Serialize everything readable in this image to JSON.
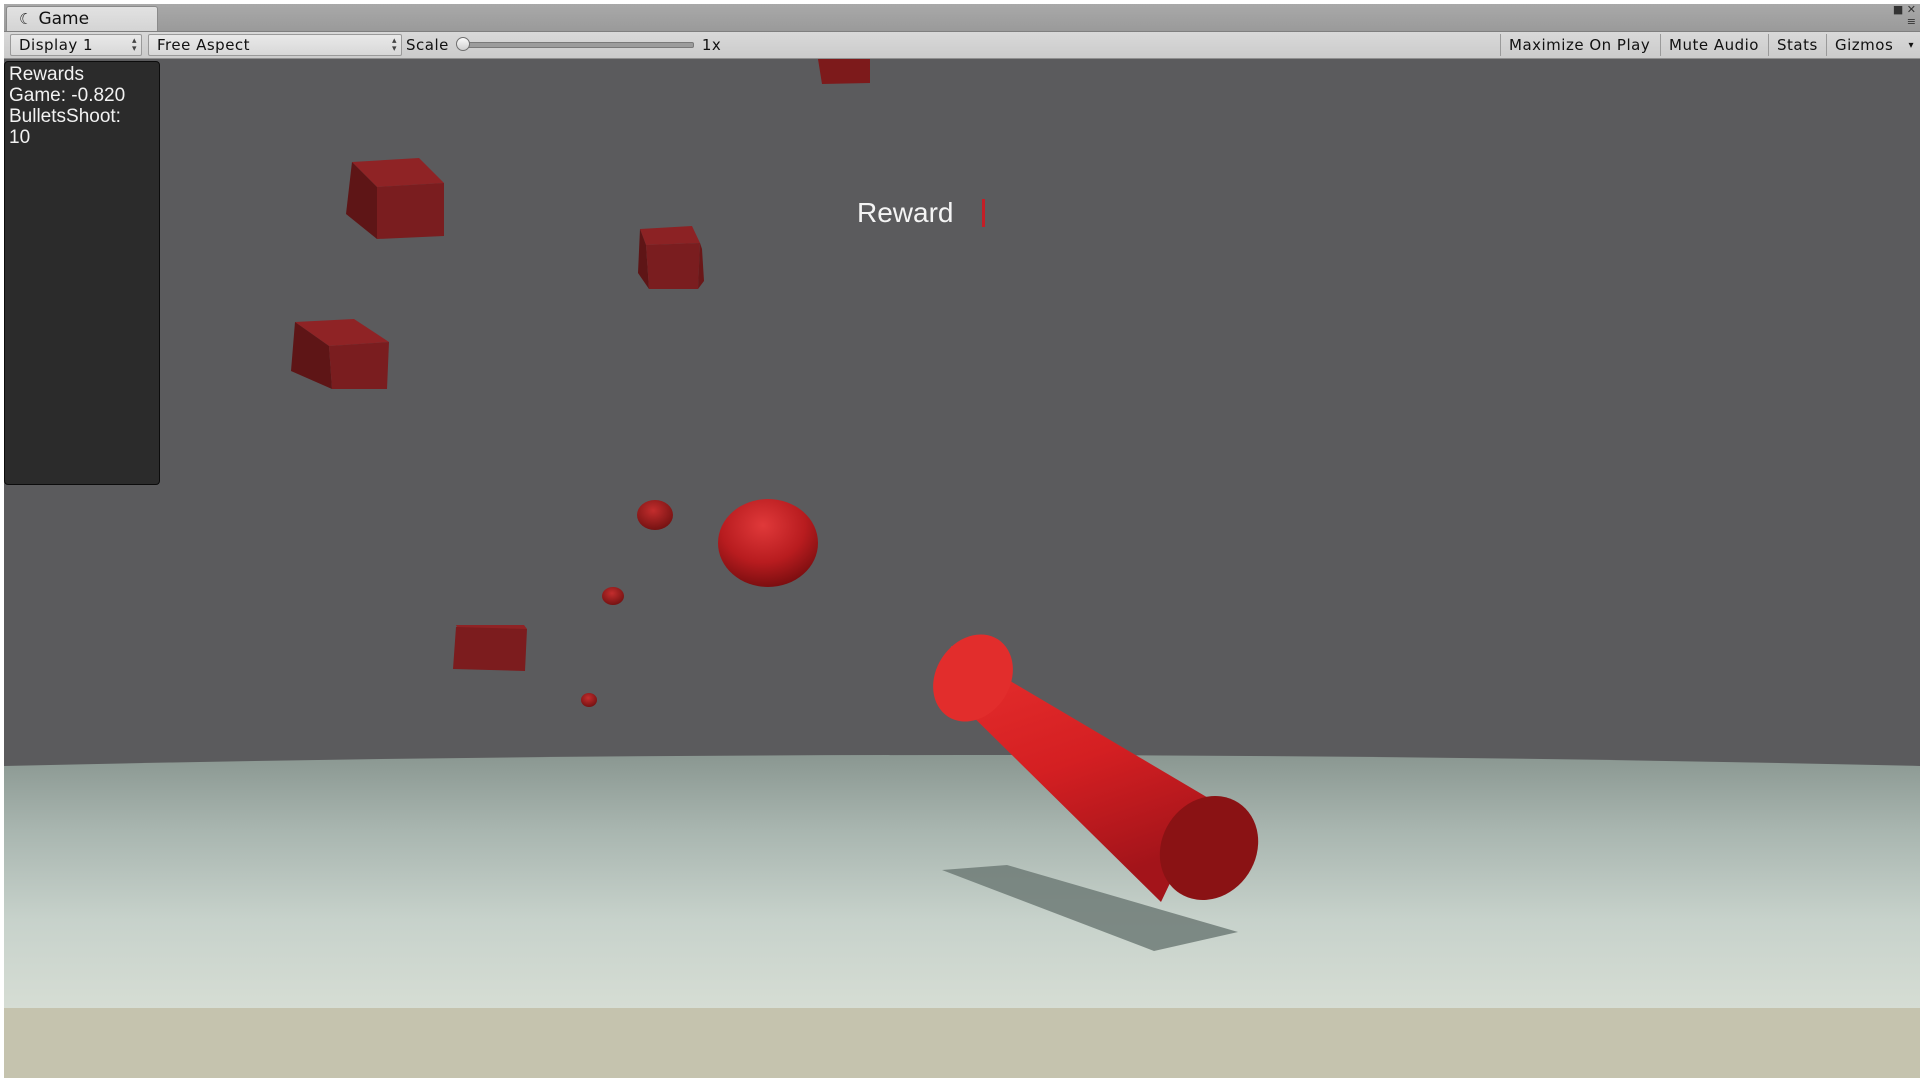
{
  "window": {
    "tab_title": "Game",
    "tab_icon": "game-icon"
  },
  "toolbar": {
    "display_select": "Display 1",
    "aspect_select": "Free Aspect",
    "scale_label": "Scale",
    "scale_value": "1x",
    "scale_level": 0,
    "maximize_on_play": "Maximize On Play",
    "mute_audio": "Mute Audio",
    "stats": "Stats",
    "gizmos": "Gizmos"
  },
  "hud": {
    "title": "Rewards",
    "game_line": "Game: -0.820",
    "bullets_label": "BulletsShoot:",
    "bullets_value": "10"
  },
  "scene": {
    "reward_label": "Reward",
    "object_color": "#d42023",
    "background_color": "#5b5b5d"
  }
}
